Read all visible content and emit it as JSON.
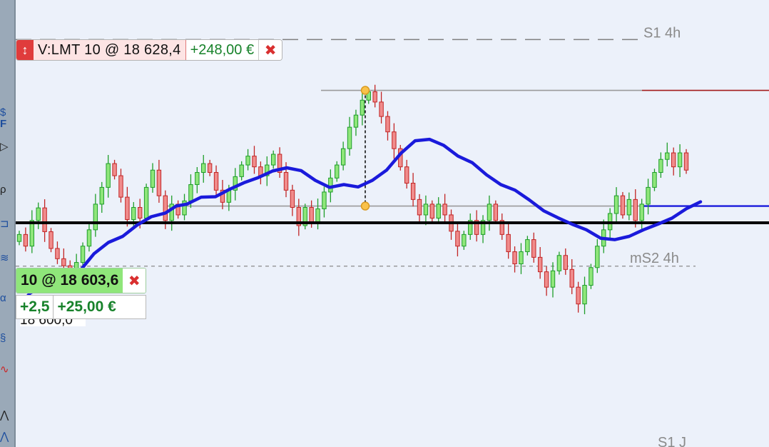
{
  "chart_data": {
    "type": "candlestick",
    "title": "",
    "price_range": [
      18552,
      18648
    ],
    "levels": [
      {
        "name": "S1 4h",
        "price": 18639.3,
        "style": "dashed",
        "color": "#7f7f7f"
      },
      {
        "name": "mS2 4h",
        "price": 18590.7,
        "style": "dotted",
        "color": "#8a8a8a"
      },
      {
        "name": "S1 J",
        "price": 18552.8,
        "style": "none",
        "color": "#8a8a8a"
      }
    ],
    "horizontal_lines": [
      {
        "price": 18600.0,
        "color": "#000000",
        "label": "18 600,0"
      },
      {
        "price": 18628.4,
        "color": "#9a9a9a"
      },
      {
        "price": 18603.6,
        "color": "#9a9a9a"
      }
    ],
    "moving_average": {
      "color": "#1a1adb",
      "points": [
        [
          0,
          18581.2
        ],
        [
          20,
          18584.9
        ],
        [
          35,
          18586.2
        ],
        [
          50,
          18586.3
        ],
        [
          70,
          18587.4
        ],
        [
          90,
          18589.7
        ],
        [
          110,
          18593.4
        ],
        [
          130,
          18595.8
        ],
        [
          150,
          18597.1
        ],
        [
          170,
          18599.5
        ],
        [
          190,
          18601.3
        ],
        [
          210,
          18602.1
        ],
        [
          225,
          18603.6
        ],
        [
          240,
          18604.0
        ],
        [
          260,
          18605.5
        ],
        [
          280,
          18605.6
        ],
        [
          300,
          18607.2
        ],
        [
          320,
          18608.6
        ],
        [
          340,
          18609.7
        ],
        [
          360,
          18611.1
        ],
        [
          380,
          18611.8
        ],
        [
          400,
          18611.2
        ],
        [
          420,
          18609.1
        ],
        [
          440,
          18607.6
        ],
        [
          460,
          18608.2
        ],
        [
          480,
          18607.7
        ],
        [
          500,
          18609.1
        ],
        [
          520,
          18611.3
        ],
        [
          540,
          18614.9
        ],
        [
          560,
          18617.6
        ],
        [
          580,
          18617.9
        ],
        [
          600,
          18616.6
        ],
        [
          620,
          18614.3
        ],
        [
          640,
          18612.9
        ],
        [
          660,
          18610.3
        ],
        [
          680,
          18608.2
        ],
        [
          700,
          18607.0
        ],
        [
          720,
          18604.9
        ],
        [
          740,
          18602.6
        ],
        [
          760,
          18601.1
        ],
        [
          780,
          18599.7
        ],
        [
          800,
          18598.5
        ],
        [
          820,
          18596.7
        ],
        [
          840,
          18596.4
        ],
        [
          860,
          18597.1
        ],
        [
          880,
          18598.5
        ],
        [
          900,
          18599.7
        ],
        [
          920,
          18601.0
        ],
        [
          940,
          18603.0
        ],
        [
          960,
          18604.5
        ]
      ]
    },
    "candles": [
      [
        18596.0,
        18597.5
      ],
      [
        18597.5,
        18595.0
      ],
      [
        18595.0,
        18600.5
      ],
      [
        18600.5,
        18603.2
      ],
      [
        18603.2,
        18598.1
      ],
      [
        18598.1,
        18594.5
      ],
      [
        18594.5,
        18592.3
      ],
      [
        18592.3,
        18590.8
      ],
      [
        18590.8,
        18588.6
      ],
      [
        18588.6,
        18591.5
      ],
      [
        18591.5,
        18595.0
      ],
      [
        18595.0,
        18598.5
      ],
      [
        18598.5,
        18604.0
      ],
      [
        18604.0,
        18607.6
      ],
      [
        18607.6,
        18612.7
      ],
      [
        18612.7,
        18610.1
      ],
      [
        18610.1,
        18605.5
      ],
      [
        18605.5,
        18600.7
      ],
      [
        18600.7,
        18603.3
      ],
      [
        18603.3,
        18601.0
      ],
      [
        18601.0,
        18607.6
      ],
      [
        18607.6,
        18611.3
      ],
      [
        18611.3,
        18605.8
      ],
      [
        18605.8,
        18600.5
      ],
      [
        18600.5,
        18604.0
      ],
      [
        18604.0,
        18601.7
      ],
      [
        18601.7,
        18604.7
      ],
      [
        18604.7,
        18608.2
      ],
      [
        18608.2,
        18610.8
      ],
      [
        18610.8,
        18612.7
      ],
      [
        18612.7,
        18610.8
      ],
      [
        18610.8,
        18607.0
      ],
      [
        18607.0,
        18604.4
      ],
      [
        18604.4,
        18607.0
      ],
      [
        18607.0,
        18609.9
      ],
      [
        18609.9,
        18612.4
      ],
      [
        18612.4,
        18614.3
      ],
      [
        18614.3,
        18612.0
      ],
      [
        18612.0,
        18610.1
      ],
      [
        18610.1,
        18612.4
      ],
      [
        18612.4,
        18614.7
      ],
      [
        18614.7,
        18610.8
      ],
      [
        18610.8,
        18607.0
      ],
      [
        18607.0,
        18603.3
      ],
      [
        18603.3,
        18599.4
      ],
      [
        18599.4,
        18603.3
      ],
      [
        18603.3,
        18600.1
      ],
      [
        18600.1,
        18603.0
      ],
      [
        18603.0,
        18606.6
      ],
      [
        18606.6,
        18609.6
      ],
      [
        18609.6,
        18612.4
      ],
      [
        18612.4,
        18615.9
      ],
      [
        18615.9,
        18620.5
      ],
      [
        18620.5,
        18623.1
      ],
      [
        18623.1,
        18626.3
      ],
      [
        18626.3,
        18628.1
      ],
      [
        18628.1,
        18625.9
      ],
      [
        18625.9,
        18622.8
      ],
      [
        18622.8,
        18619.5
      ],
      [
        18619.5,
        18615.9
      ],
      [
        18615.9,
        18612.0
      ],
      [
        18612.0,
        18608.5
      ],
      [
        18608.5,
        18605.0
      ],
      [
        18605.0,
        18601.7
      ],
      [
        18601.7,
        18604.0
      ],
      [
        18604.0,
        18601.0
      ],
      [
        18601.0,
        18604.0
      ],
      [
        18604.0,
        18601.7
      ],
      [
        18601.7,
        18598.2
      ],
      [
        18598.2,
        18595.0
      ],
      [
        18595.0,
        18597.5
      ],
      [
        18597.5,
        18600.5
      ],
      [
        18600.5,
        18597.5
      ],
      [
        18597.5,
        18600.5
      ],
      [
        18600.5,
        18604.0
      ],
      [
        18604.0,
        18600.5
      ],
      [
        18600.5,
        18597.5
      ],
      [
        18597.5,
        18593.8
      ],
      [
        18593.8,
        18591.2
      ],
      [
        18591.2,
        18593.8
      ],
      [
        18593.8,
        18596.4
      ],
      [
        18596.4,
        18592.6
      ],
      [
        18592.6,
        18589.5
      ],
      [
        18589.5,
        18586.2
      ],
      [
        18586.2,
        18589.7
      ],
      [
        18589.7,
        18593.0
      ],
      [
        18593.0,
        18590.0
      ],
      [
        18590.0,
        18586.2
      ],
      [
        18586.2,
        18582.6
      ],
      [
        18582.6,
        18586.6
      ],
      [
        18586.6,
        18590.4
      ],
      [
        18590.4,
        18595.0
      ],
      [
        18595.0,
        18598.5
      ],
      [
        18598.5,
        18602.0
      ],
      [
        18602.0,
        18605.8
      ],
      [
        18605.8,
        18601.7
      ],
      [
        18601.7,
        18605.0
      ],
      [
        18605.0,
        18600.5
      ],
      [
        18600.5,
        18604.0
      ],
      [
        18604.0,
        18607.6
      ],
      [
        18607.6,
        18610.8
      ],
      [
        18610.8,
        18613.6
      ],
      [
        18613.6,
        18615.0
      ],
      [
        18615.0,
        18612.0
      ],
      [
        18612.0,
        18615.0
      ],
      [
        18615.0,
        18611.3
      ]
    ]
  },
  "overlays": {
    "sell_order": {
      "desc": "V:LMT  10  @  18 628,4",
      "pnl": "+248,00 €",
      "grip": "↕",
      "close": "✖"
    },
    "position": {
      "qty_price": "10  @  18 603,6",
      "close": "✖",
      "points": "+2,5",
      "amount": "+25,00 €"
    },
    "price_tag": "18 600,0"
  },
  "toolbar_glyphs": [
    "$",
    "F",
    "▷",
    "ρ",
    "⊐",
    "≋",
    "α",
    "§",
    "∿",
    "⋀",
    "⋀"
  ]
}
